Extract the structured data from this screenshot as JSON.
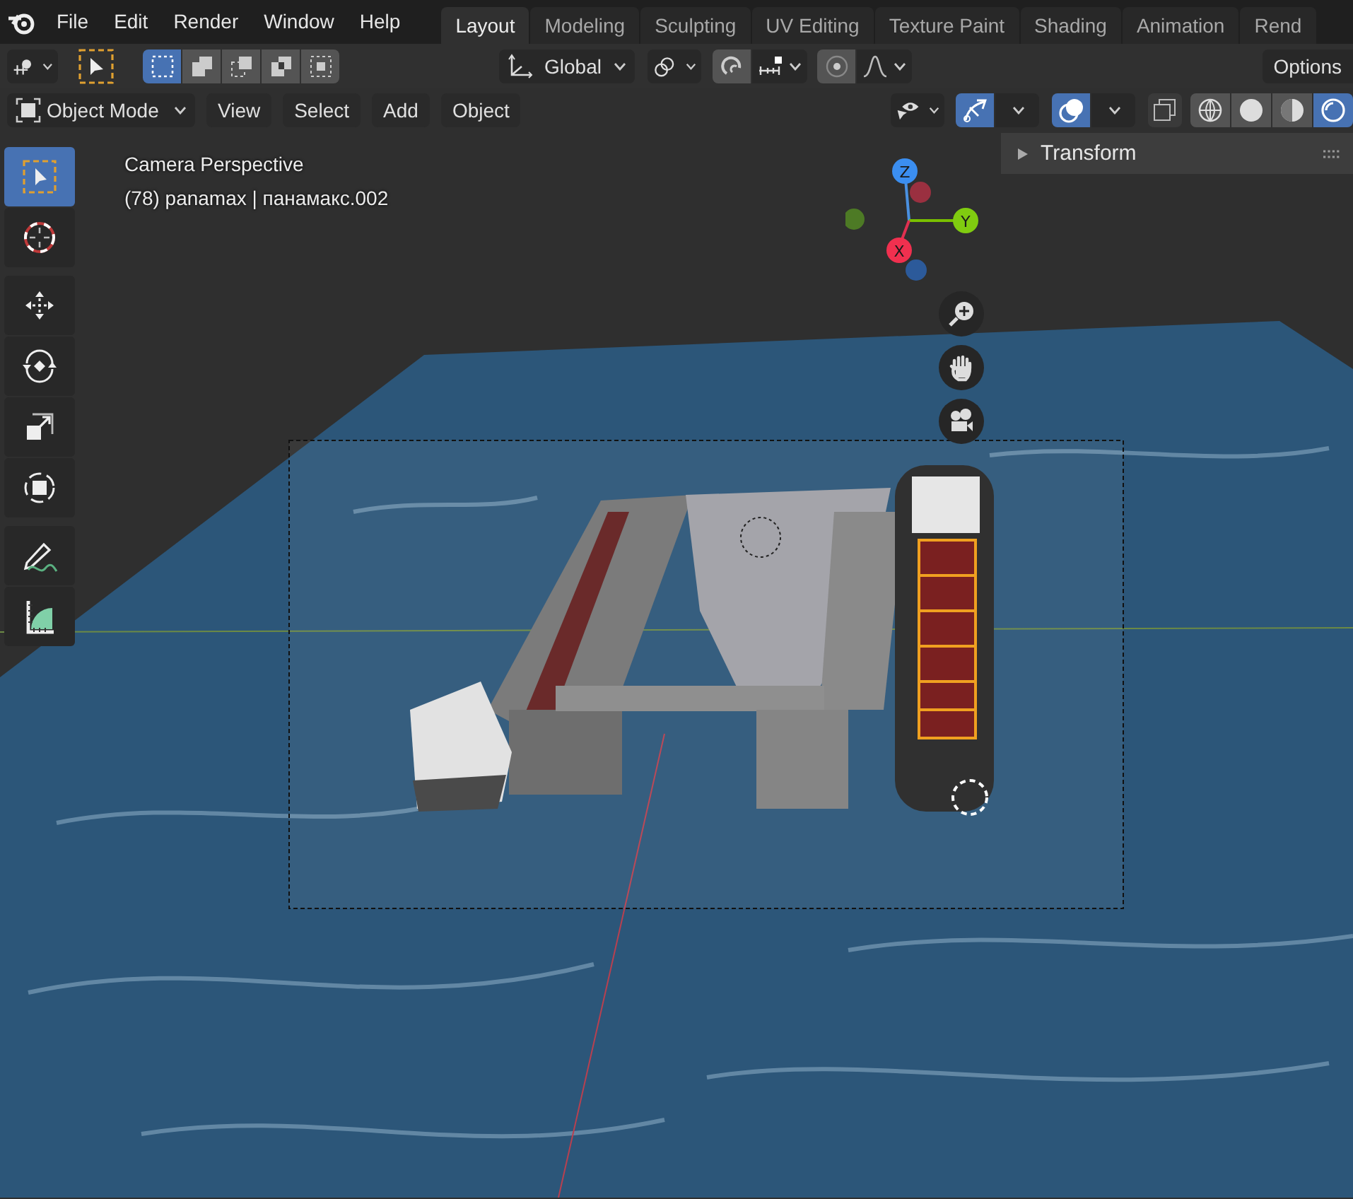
{
  "menu": [
    "File",
    "Edit",
    "Render",
    "Window",
    "Help"
  ],
  "workspace_tabs": [
    {
      "label": "Layout",
      "selected": true
    },
    {
      "label": "Modeling",
      "selected": false
    },
    {
      "label": "Sculpting",
      "selected": false
    },
    {
      "label": "UV Editing",
      "selected": false
    },
    {
      "label": "Texture Paint",
      "selected": false
    },
    {
      "label": "Shading",
      "selected": false
    },
    {
      "label": "Animation",
      "selected": false
    },
    {
      "label": "Rend",
      "selected": false
    }
  ],
  "tool_header": {
    "select_modes": [
      {
        "kind": "set",
        "selected": true
      },
      {
        "kind": "extend",
        "selected": false
      },
      {
        "kind": "subtract",
        "selected": false
      },
      {
        "kind": "difference",
        "selected": false
      },
      {
        "kind": "intersect",
        "selected": false
      }
    ],
    "transform_orientation": "Global",
    "snap": {
      "on": false
    },
    "proportional_editing": {
      "on": false
    },
    "options": "Options"
  },
  "viewport_header": {
    "mode": "Object Mode",
    "menus": [
      "View",
      "Select",
      "Add",
      "Object"
    ],
    "gizmos": {
      "on": true
    },
    "overlays": {
      "on": true
    },
    "xray": {
      "on": false
    },
    "shading_modes": [
      {
        "kind": "wireframe",
        "selected": false
      },
      {
        "kind": "solid",
        "selected": false
      },
      {
        "kind": "material",
        "selected": false
      },
      {
        "kind": "rendered",
        "selected": true
      }
    ]
  },
  "toolbar": [
    {
      "kind": "select",
      "selected": true
    },
    {
      "kind": "cursor",
      "selected": false
    },
    {
      "kind": "move",
      "selected": false
    },
    {
      "kind": "rotate",
      "selected": false
    },
    {
      "kind": "scale",
      "selected": false
    },
    {
      "kind": "transform",
      "selected": false
    },
    {
      "kind": "annotate",
      "selected": false
    },
    {
      "kind": "measure",
      "selected": false
    }
  ],
  "viewport": {
    "view_name": "Camera Perspective",
    "object_info": "(78) panamax | панамакс.002",
    "axes": [
      {
        "label": "Z"
      },
      {
        "label": "Y"
      },
      {
        "label": "X"
      }
    ]
  },
  "sidebar_panel": {
    "title": "Transform",
    "expanded": false
  }
}
